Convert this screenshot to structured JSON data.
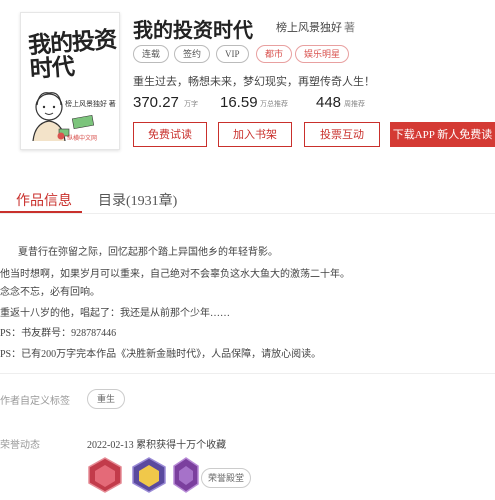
{
  "cover": {
    "title": "我的投资时代",
    "author": "榜上风景独好 著",
    "publisher": "纵横中文网"
  },
  "book": {
    "title": "我的投资时代",
    "author": "榜上风景独好",
    "author_suffix": "著",
    "tags": [
      "连载",
      "签约",
      "VIP",
      "都市",
      "娱乐明星"
    ],
    "intro": "重生过去，畅想未来，梦幻现实，再塑传奇人生！",
    "stats": [
      {
        "value": "370.27",
        "unit": "万字"
      },
      {
        "value": "16.59",
        "unit": "万总推荐"
      },
      {
        "value": "448",
        "unit": "周推荐"
      }
    ]
  },
  "buttons": {
    "free_read": "免费试读",
    "add_shelf": "加入书架",
    "vote": "投票互动",
    "download": "下载APP  新人免费读"
  },
  "tabs": {
    "info": "作品信息",
    "catalog": "目录(1931章)"
  },
  "description": [
    "夏昔行在弥留之际，回忆起那个踏上异国他乡的年轻背影。",
    "他当时想啊，如果岁月可以重来，自己绝对不会辜负这水大鱼大的激荡二十年。",
    "念念不忘，必有回响。",
    "重返十八岁的他，唱起了：我还是从前那个少年……",
    "PS：书友群号：928787446",
    "PS：已有200万字完本作品《决胜新金融时代》，人品保障，请放心阅读。"
  ],
  "custom_tag": {
    "label": "作者自定义标签",
    "value": "重生"
  },
  "honors": {
    "label": "荣誉动态",
    "date_line": "2022-02-13  累积获得十万个收藏",
    "more": "荣誉殿堂"
  },
  "colors": {
    "accent": "#c9302c",
    "badge1": "#c23b4a",
    "badge2": "#5a4a9e",
    "badge3": "#7b3f9e"
  }
}
